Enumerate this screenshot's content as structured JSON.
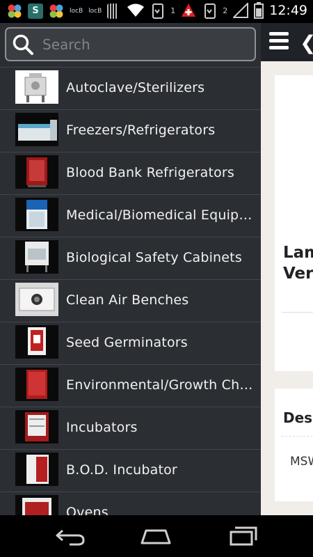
{
  "status_bar": {
    "left_icons": [
      "app-flower-icon",
      "s-app-icon",
      "app-flower-icon",
      "locb-icon",
      "locb-icon",
      "barcode-icon"
    ],
    "locb_label": "locB",
    "sim1": "1",
    "sim2": "2",
    "clock": "12:49"
  },
  "search": {
    "placeholder": "Search",
    "value": ""
  },
  "menu": {
    "items": [
      {
        "label": "Autoclave/Sterilizers",
        "thumb": "autoclave"
      },
      {
        "label": "Freezers/Refrigerators",
        "thumb": "freezer"
      },
      {
        "label": "Blood Bank Refrigerators",
        "thumb": "red-cabinet"
      },
      {
        "label": "Medical/Biomedical Equipm…",
        "thumb": "blue-cabinet"
      },
      {
        "label": "Biological Safety Cabinets",
        "thumb": "safety-cabinet"
      },
      {
        "label": "Clean Air Benches",
        "thumb": "bench"
      },
      {
        "label": "Seed Germinators",
        "thumb": "germinator"
      },
      {
        "label": "Environmental/Growth Cha…",
        "thumb": "red-cabinet"
      },
      {
        "label": "Incubators",
        "thumb": "incubator"
      },
      {
        "label": "B.O.D. Incubator",
        "thumb": "bod"
      },
      {
        "label": "Ovens",
        "thumb": "oven"
      }
    ]
  },
  "app": {
    "card_title_line1": "Lam",
    "card_title_line2": "Vert",
    "desc_heading": "Desc",
    "desc_value": "MSW"
  },
  "colors": {
    "drawer_bg": "#2b2e33",
    "app_bar": "#1f2226",
    "content_bg": "#f1ede8",
    "status_bg": "#000000"
  }
}
